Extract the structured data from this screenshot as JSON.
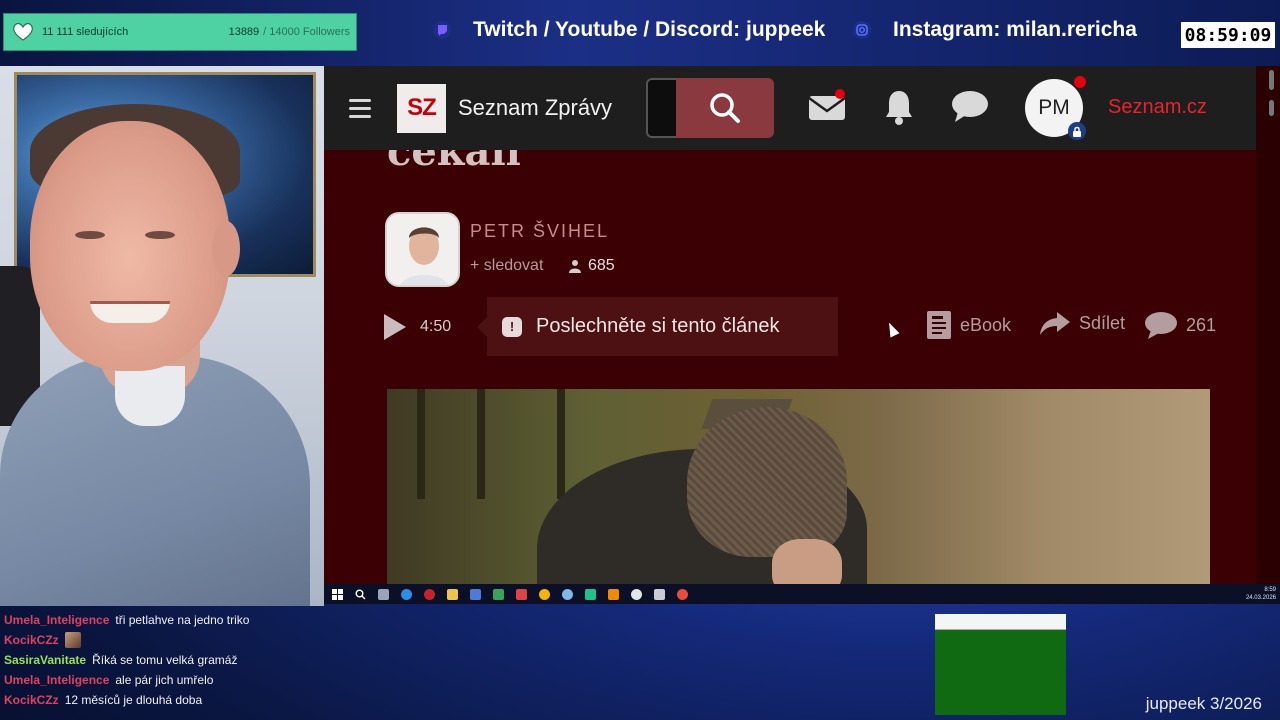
{
  "stream_overlay": {
    "follower_goal": {
      "label": "11 111 sledujících",
      "current": "13889",
      "total": "/ 14000 Followers",
      "icon": "heart-hands-icon"
    },
    "socials": [
      {
        "icon": "twitch-icon",
        "text": "Twitch / Youtube / Discord: juppeek",
        "color": "#7a5cff"
      },
      {
        "icon": "instagram-icon",
        "text": "Instagram: milan.rericha",
        "color": "#5b6cff"
      }
    ],
    "clock": "08:59:09",
    "watermark": "juppeek 3/2026"
  },
  "browser": {
    "site": {
      "logo_text": "SZ",
      "name": "Seznam Zprávy",
      "avatar_initials": "PM",
      "external_link": "Seznam.cz",
      "accent_color": "#e8242c",
      "background_color": "#3a0003"
    },
    "article": {
      "title_fragment": "čekali",
      "author": "PETR ŠVIHEL",
      "follow_label": "+ sledovat",
      "followers": "685",
      "audio_duration": "4:50",
      "listen_label": "Poslechněte si tento článek",
      "ebook_label": "eBook",
      "share_label": "Sdílet",
      "comments_count": "261"
    }
  },
  "taskbar": {
    "time": "8:59",
    "date": "24.03.2026"
  },
  "chat": [
    {
      "user": "Umela_Inteligence",
      "color": "#e0415f",
      "message": "tři petlahve na jedno triko"
    },
    {
      "user": "KocikCZz",
      "color": "#e0415f",
      "message": "",
      "emote": "emote-icon"
    },
    {
      "user": "SasiraVanitate",
      "color": "#9be052",
      "message": "Říká se tomu velká gramáž"
    },
    {
      "user": "Umela_Inteligence",
      "color": "#e0415f",
      "message": "ale pár jich umřelo"
    },
    {
      "user": "KocikCZz",
      "color": "#e0415f",
      "message": "12 měsíců je dlouhá doba"
    }
  ]
}
